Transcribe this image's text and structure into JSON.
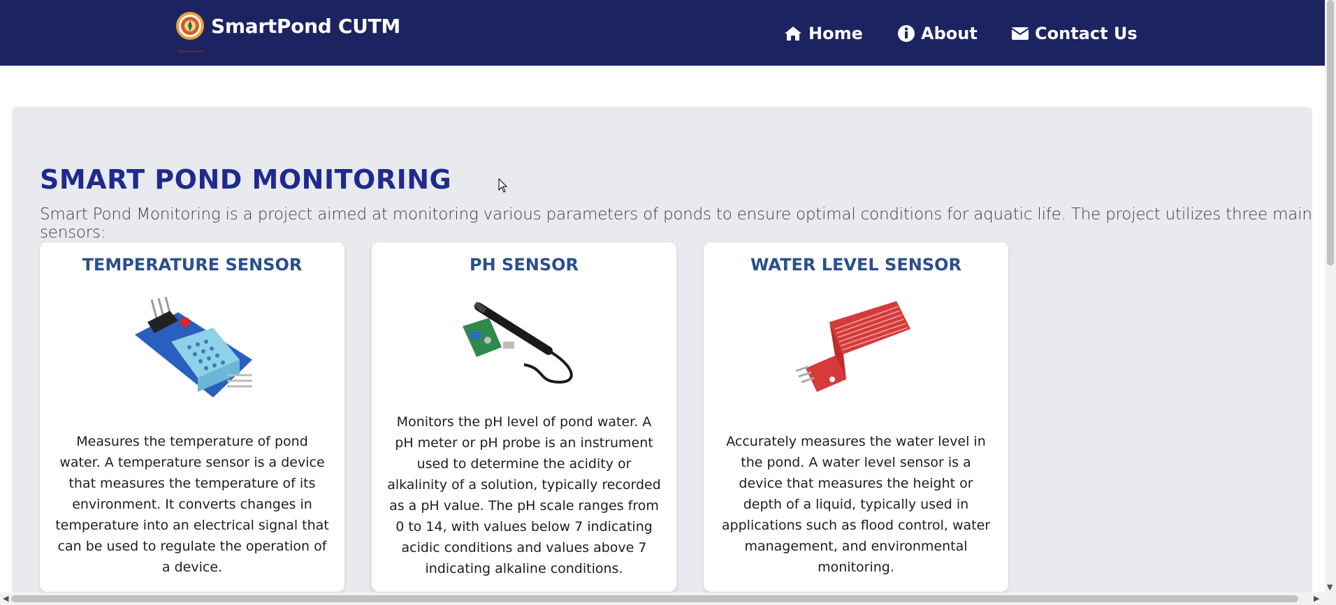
{
  "header": {
    "brand": "SmartPond CUTM",
    "nav": [
      {
        "label": "Home",
        "icon": "home-icon"
      },
      {
        "label": "About",
        "icon": "info-icon"
      },
      {
        "label": "Contact Us",
        "icon": "envelope-icon"
      }
    ]
  },
  "main": {
    "title": "SMART POND MONITORING",
    "intro": "Smart Pond Monitoring is a project aimed at monitoring various parameters of ponds to ensure optimal conditions for aquatic life. The project utilizes three main sensors:",
    "cards": [
      {
        "title": "TEMPERATURE SENSOR",
        "image": "temperature-sensor-image",
        "description": "Measures the temperature of pond water. A temperature sensor is a device that measures the temperature of its environment. It converts changes in temperature into an electrical signal that can be used to regulate the operation of a device."
      },
      {
        "title": "PH SENSOR",
        "image": "ph-sensor-image",
        "description": "Monitors the pH level of pond water. A pH meter or pH probe is an instrument used to determine the acidity or alkalinity of a solution, typically recorded as a pH value. The pH scale ranges from 0 to 14, with values below 7 indicating acidic conditions and values above 7 indicating alkaline conditions."
      },
      {
        "title": "WATER LEVEL SENSOR",
        "image": "water-level-sensor-image",
        "description": "Accurately measures the water level in the pond. A water level sensor is a device that measures the height or depth of a liquid, typically used in applications such as flood control, water management, and environmental monitoring."
      }
    ]
  },
  "colors": {
    "navbar": "#1c2361",
    "title": "#1f2a8e",
    "card_title": "#2b4f8a",
    "section_bg": "#e9eaee"
  }
}
